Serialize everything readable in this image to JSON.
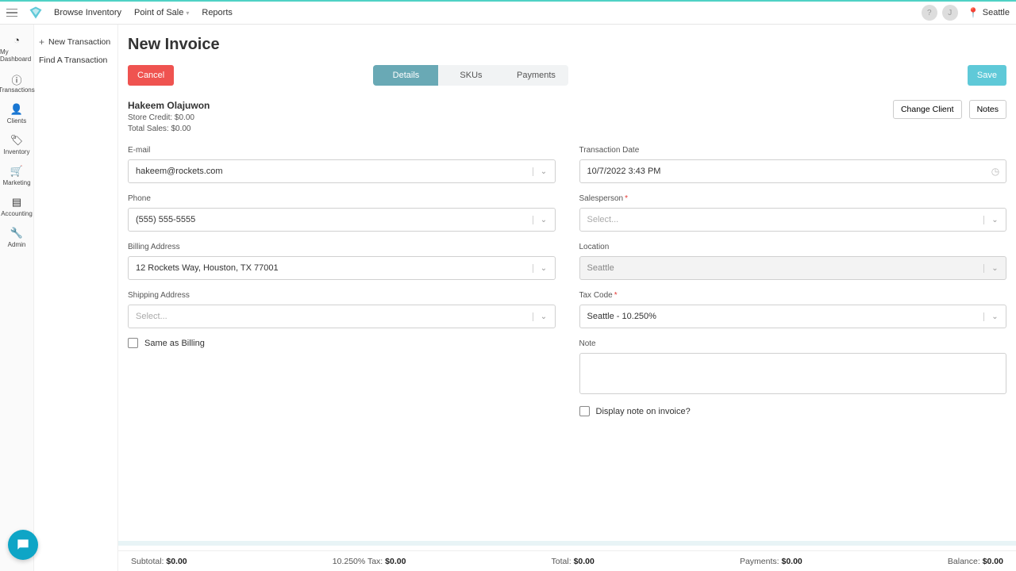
{
  "topnav": {
    "browse": "Browse Inventory",
    "pos": "Point of Sale",
    "reports": "Reports"
  },
  "topright": {
    "help": "?",
    "user": "J",
    "location": "Seattle"
  },
  "sidebar": [
    {
      "id": "dashboard",
      "label": "My Dashboard",
      "icon": "◔"
    },
    {
      "id": "transactions",
      "label": "Transactions",
      "icon": "ⓘ"
    },
    {
      "id": "clients",
      "label": "Clients",
      "icon": "👤"
    },
    {
      "id": "inventory",
      "label": "Inventory",
      "icon": "🏷"
    },
    {
      "id": "marketing",
      "label": "Marketing",
      "icon": "🛒"
    },
    {
      "id": "accounting",
      "label": "Accounting",
      "icon": "▤"
    },
    {
      "id": "admin",
      "label": "Admin",
      "icon": "🔧"
    }
  ],
  "subnav": {
    "new": "New Transaction",
    "find": "Find A Transaction"
  },
  "page": {
    "title": "New Invoice",
    "cancel": "Cancel",
    "save": "Save",
    "tabs": {
      "details": "Details",
      "skus": "SKUs",
      "payments": "Payments"
    }
  },
  "client": {
    "name": "Hakeem Olajuwon",
    "credit": "Store Credit: $0.00",
    "sales": "Total Sales: $0.00",
    "change": "Change Client",
    "notes": "Notes"
  },
  "left": {
    "email_label": "E-mail",
    "email": "hakeem@rockets.com",
    "phone_label": "Phone",
    "phone": "(555) 555-5555",
    "billing_label": "Billing Address",
    "billing": "12 Rockets Way, Houston, TX 77001",
    "shipping_label": "Shipping Address",
    "shipping_placeholder": "Select...",
    "same": "Same as Billing"
  },
  "right": {
    "date_label": "Transaction Date",
    "date": "10/7/2022 3:43 PM",
    "sales_label": "Salesperson",
    "sales_placeholder": "Select...",
    "loc_label": "Location",
    "loc": "Seattle",
    "tax_label": "Tax Code",
    "tax": "Seattle - 10.250%",
    "note_label": "Note",
    "display": "Display note on invoice?"
  },
  "footer": {
    "sub_l": "Subtotal: ",
    "sub_v": "$0.00",
    "tax_l": "10.250% Tax: ",
    "tax_v": "$0.00",
    "tot_l": "Total: ",
    "tot_v": "$0.00",
    "pay_l": "Payments: ",
    "pay_v": "$0.00",
    "bal_l": "Balance: ",
    "bal_v": "$0.00"
  }
}
